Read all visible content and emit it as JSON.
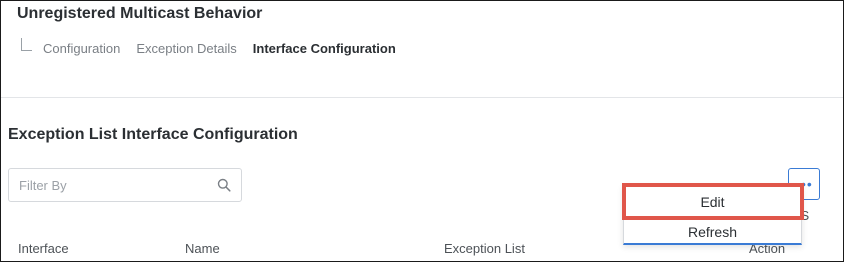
{
  "header": {
    "title": "Unregistered Multicast Behavior",
    "breadcrumb": [
      "Configuration",
      "Exception Details",
      "Interface Configuration"
    ]
  },
  "section": {
    "title": "Exception List Interface Configuration"
  },
  "filter": {
    "placeholder": "Filter By",
    "value": ""
  },
  "actions": {
    "label": "ONS",
    "menu": [
      "Edit",
      "Refresh"
    ]
  },
  "table": {
    "columns": [
      "Interface",
      "Name",
      "Exception List",
      "Action"
    ]
  },
  "colors": {
    "accent": "#3a7bd5",
    "highlight": "#e0564a"
  },
  "icons": {
    "search": "search-icon",
    "more": "more-dots-icon",
    "breadcrumb_connector": "tree-connector-icon"
  }
}
